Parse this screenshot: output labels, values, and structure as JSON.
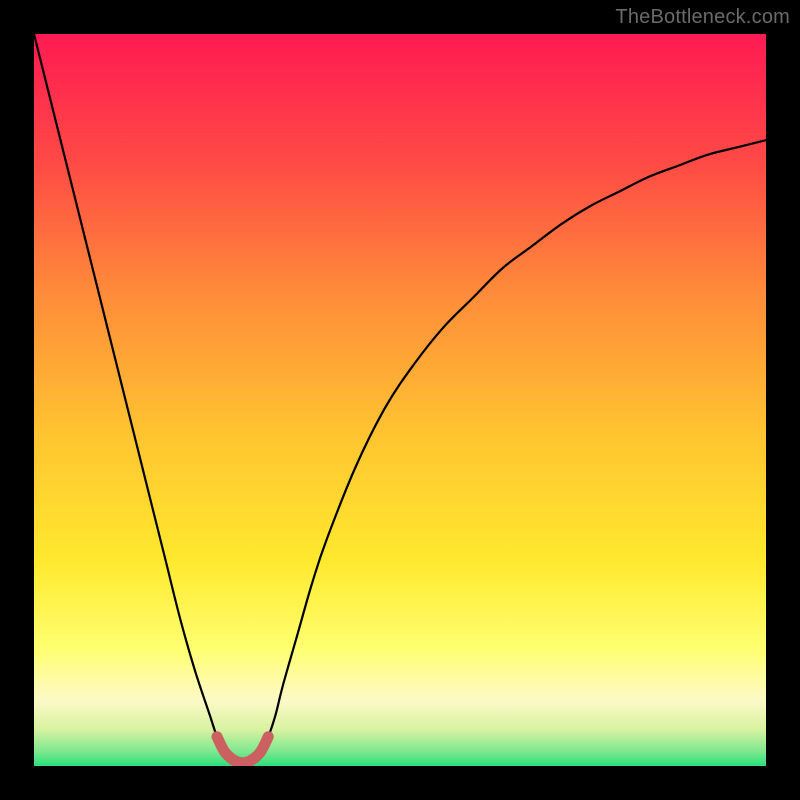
{
  "attribution": "TheBottleneck.com",
  "colors": {
    "frame": "#000000",
    "gradient_top": "#ff1a52",
    "gradient_mid_upper": "#ff6a3a",
    "gradient_mid": "#ffd530",
    "gradient_lower": "#ffff70",
    "gradient_cream": "#fdf9c8",
    "gradient_bottom": "#2be07a",
    "curve": "#000000",
    "highlight": "#cc6060"
  },
  "chart_data": {
    "type": "line",
    "title": "",
    "xlabel": "",
    "ylabel": "",
    "xlim": [
      0,
      100
    ],
    "ylim": [
      0,
      100
    ],
    "series": [
      {
        "name": "bottleneck-curve",
        "x": [
          0,
          2,
          4,
          6,
          8,
          10,
          12,
          14,
          16,
          18,
          20,
          22,
          24,
          25,
          26,
          27,
          28,
          29,
          30,
          31,
          32,
          33,
          34,
          36,
          38,
          40,
          44,
          48,
          52,
          56,
          60,
          64,
          68,
          72,
          76,
          80,
          84,
          88,
          92,
          96,
          100
        ],
        "y": [
          100,
          92,
          84,
          76,
          68,
          60,
          52,
          44,
          36,
          28,
          20,
          13,
          7,
          4,
          2,
          1,
          0.5,
          0.5,
          1,
          2,
          4,
          7,
          11,
          18,
          25,
          31,
          41,
          49,
          55,
          60,
          64,
          68,
          71,
          74,
          76.5,
          78.5,
          80.5,
          82,
          83.5,
          84.5,
          85.5
        ]
      },
      {
        "name": "optimal-band",
        "x": [
          25,
          26,
          27,
          28,
          29,
          30,
          31,
          32
        ],
        "y": [
          4,
          2,
          1,
          0.5,
          0.5,
          1,
          2,
          4
        ]
      }
    ],
    "annotations": []
  }
}
